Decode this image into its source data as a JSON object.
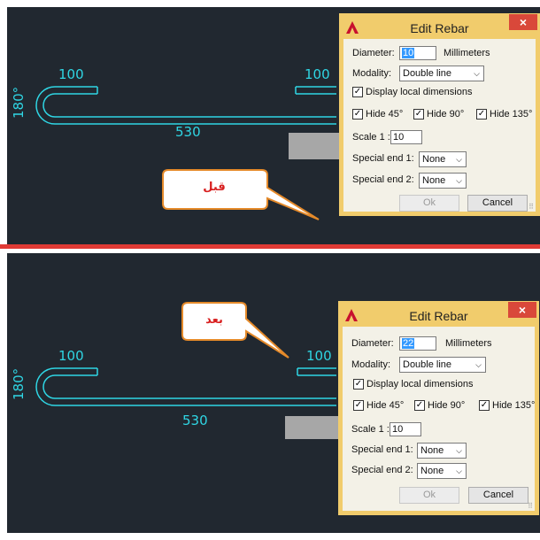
{
  "top": {
    "labels": {
      "top_left": "100",
      "top_right": "100",
      "bottom": "530",
      "angle": "180°"
    },
    "callout": "قبل",
    "dialog": {
      "title": "Edit Rebar",
      "close": "×",
      "diameter_label": "Diameter:",
      "diameter_value": "10",
      "units": "Millimeters",
      "modality_label": "Modality:",
      "modality_value": "Double line",
      "display_local": "Display local dimensions",
      "hide45": "Hide 45°",
      "hide90": "Hide 90°",
      "hide135": "Hide 135°",
      "scale_label": "Scale 1 :",
      "scale_value": "10",
      "special1_label": "Special end 1:",
      "special1_value": "None",
      "special2_label": "Special end 2:",
      "special2_value": "None",
      "ok": "Ok",
      "cancel": "Cancel"
    }
  },
  "bottom": {
    "labels": {
      "top_left": "100",
      "top_right": "100",
      "bottom": "530",
      "angle": "180°"
    },
    "callout": "بعد",
    "dialog": {
      "title": "Edit Rebar",
      "close": "×",
      "diameter_label": "Diameter:",
      "diameter_value": "22",
      "units": "Millimeters",
      "modality_label": "Modality:",
      "modality_value": "Double line",
      "display_local": "Display local dimensions",
      "hide45": "Hide 45°",
      "hide90": "Hide 90°",
      "hide135": "Hide 135°",
      "scale_label": "Scale 1 :",
      "scale_value": "10",
      "special1_label": "Special end 1:",
      "special1_value": "None",
      "special2_label": "Special end 2:",
      "special2_value": "None",
      "ok": "Ok",
      "cancel": "Cancel"
    }
  },
  "colors": {
    "canvas_bg": "#212830",
    "rebar": "#2fd6e4",
    "divider": "#e03a35",
    "dialog_frame": "#f1cc6c",
    "callout_text": "#d81f1f"
  }
}
